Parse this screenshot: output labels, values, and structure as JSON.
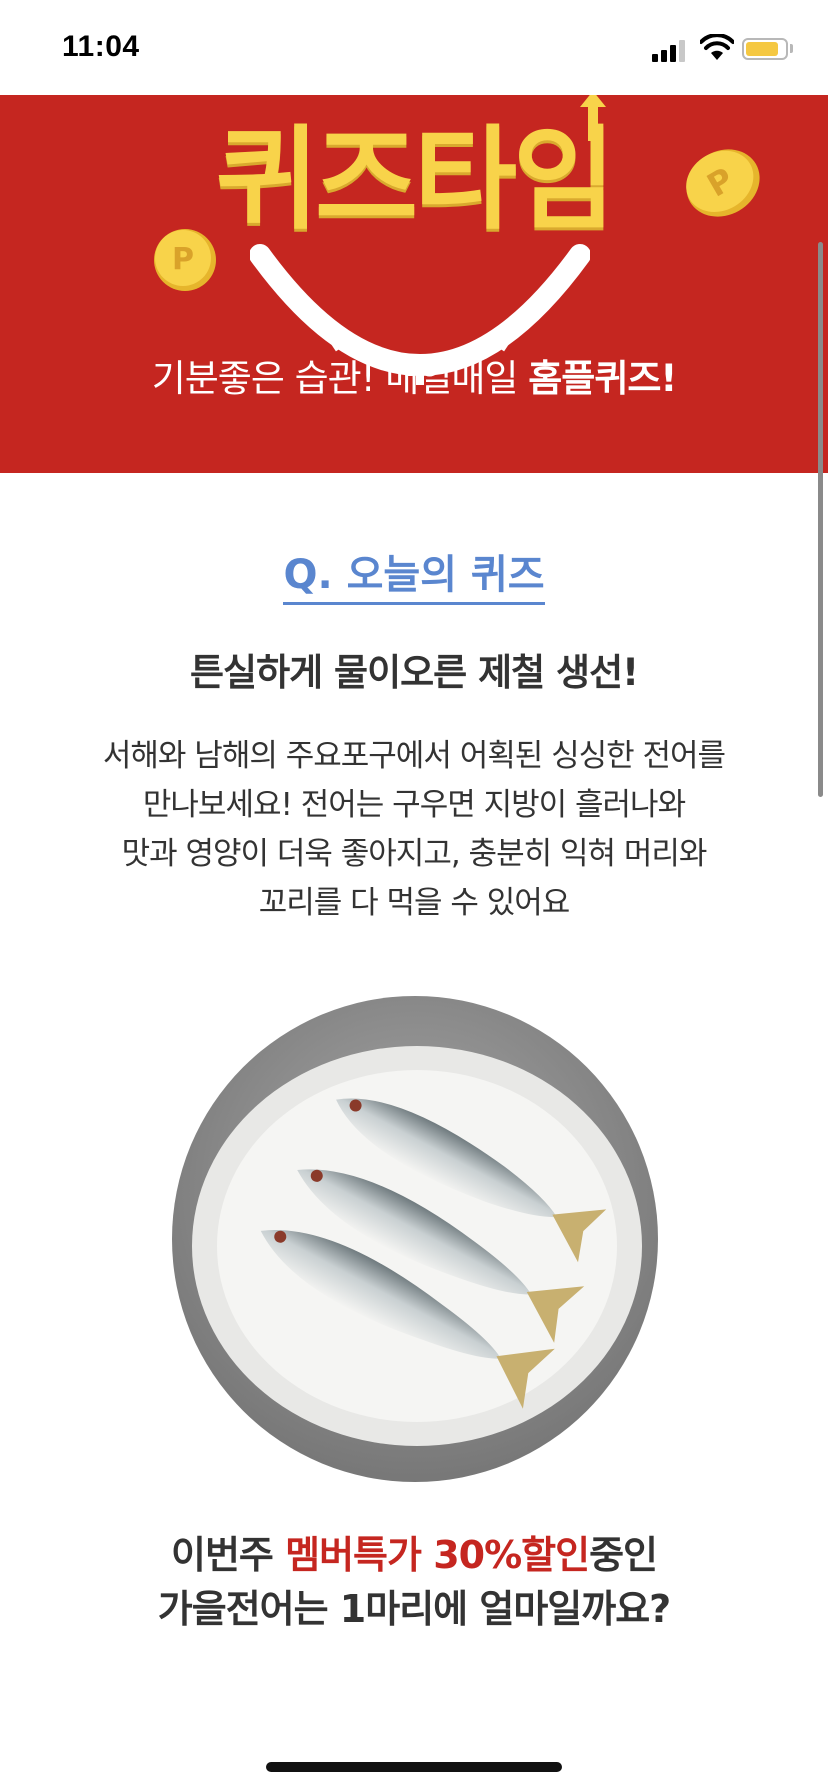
{
  "status_bar": {
    "time": "11:04",
    "icons": [
      "signal-icon",
      "wifi-icon",
      "battery-icon"
    ],
    "battery_level": 0.85
  },
  "banner": {
    "title": "퀴즈타임",
    "subtitle_normal": "기분좋은 습관! 매일매일 ",
    "subtitle_bold": "홈플퀴즈!",
    "background_color": "#c52620",
    "title_color": "#f8d34a",
    "coin_label": "P"
  },
  "quiz": {
    "heading": "Q. 오늘의 퀴즈",
    "title": "튼실하게 물이오른 제철 생선!",
    "description_lines": [
      "서해와 남해의 주요포구에서 어획된 싱싱한 전어를",
      "만나보세요! 전어는 구우면 지방이 흘러나와",
      "맛과 영양이 더욱 좋아지고, 충분히 익혀 머리와",
      "꼬리를 다 먹을 수 있어요"
    ],
    "question_line1_prefix": "이번주 ",
    "question_line1_highlight": "멤버특가 30%할인",
    "question_line1_suffix": "중인",
    "question_line2": "가을전어는 1마리에 얼마일까요?",
    "accent_color": "#5a86cf",
    "highlight_color": "#c52620"
  }
}
